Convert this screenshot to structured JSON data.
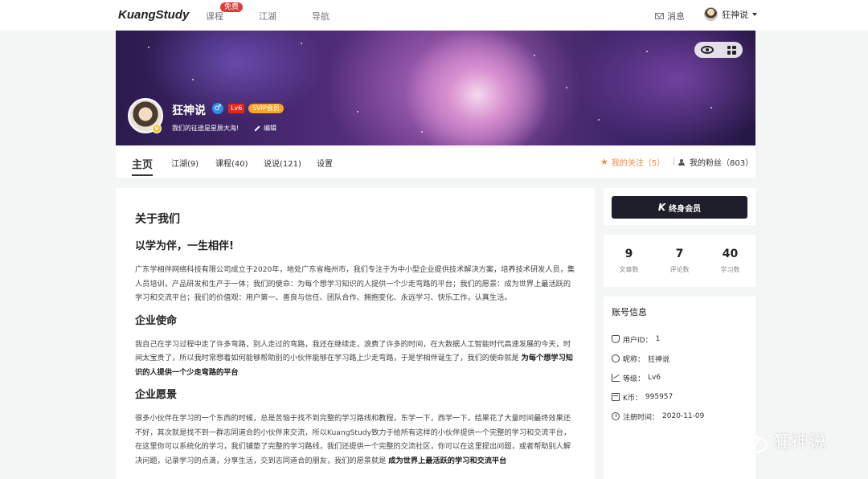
{
  "topnav": {
    "logo": "KuangStudy",
    "links": [
      "课程",
      "江湖",
      "导航"
    ],
    "free_badge": "免费",
    "messages_label": "消息",
    "user_name": "狂神说"
  },
  "profile": {
    "name": "狂神说",
    "level_badge": "Lv6",
    "vip_badge": "SVIP会员",
    "verified_badge": "V",
    "motto": "我们的征途是星辰大海!",
    "edit_label": "编辑"
  },
  "tabs": {
    "items": [
      "主页",
      "江湖(9)",
      "课程(40)",
      "说说(121)",
      "设置"
    ],
    "following_label": "我的关注（5）",
    "fans_label": "我的粉丝（803）"
  },
  "article": {
    "title": "关于我们",
    "subtitle": "以学为伴，一生相伴!",
    "intro": "广东学相伴网络科技有限公司成立于2020年，地处广东省梅州市，我们专注于为中小型企业提供技术解决方案，培养技术研发人员，集人员培训，产品研发和生产于一体；我们的使命：为每个想学习知识的人提供一个少走弯路的平台；我们的愿景：成为世界上最活跃的学习和交流平台；我们的价值观：用户第一、善良与信任、团队合作、拥抱变化、永远学习、快乐工作，认真生活。",
    "mission_title": "企业使命",
    "mission_text": "我自己在学习过程中走了许多弯路，别人走过的弯路，我还在继续走，浪费了许多的时间，在大数据人工智能时代高速发展的今天，时间太宝贵了，所以我时常想着如何能够帮助别的小伙伴能够在学习路上少走弯路，于是学相伴诞生了，我们的使命就是",
    "mission_bold": "为每个想学习知识的人提供一个少走弯路的平台",
    "vision_title": "企业愿景",
    "vision_text": "很多小伙伴在学习的一个东西的时候，总是苦恼于找不到完整的学习路线和教程，东学一下，西学一下，结果花了大量时间最终效果还不好，其次就是找不到一群志同道合的小伙伴来交流，所以KuangStudy致力于给所有这样的小伙伴提供一个完整的学习和交流平台，在这里你可以系统化的学习，我们铺垫了完整的学习路线，我们还提供一个完整的交流社区，你可以在这里提出问题，或者帮助别人解决问题，记录学习的点滴，分享生活，交到志同道合的朋友，我们的愿景就是",
    "vision_bold": "成为世界上最活跃的学习和交流平台"
  },
  "sidebar": {
    "vip_button": "终身会员",
    "stats": [
      {
        "value": "9",
        "label": "文章数"
      },
      {
        "value": "7",
        "label": "评论数"
      },
      {
        "value": "40",
        "label": "学习数"
      }
    ],
    "account_title": "账号信息",
    "account_rows": [
      {
        "label": "用户ID：",
        "value": "1"
      },
      {
        "label": "昵称：",
        "value": "狂神说"
      },
      {
        "label": "等级：",
        "value": "Lv6"
      },
      {
        "label": "K币：",
        "value": "995957"
      },
      {
        "label": "注册时间：",
        "value": "2020-11-09"
      }
    ]
  },
  "watermark": "狂神说",
  "colors": {
    "accent_orange": "#f08a3c",
    "vip_button_bg": "#1f1f2b",
    "level_red": "#e6271f",
    "svip_orange": "#f6a623",
    "male_blue": "#2d8cf0"
  }
}
